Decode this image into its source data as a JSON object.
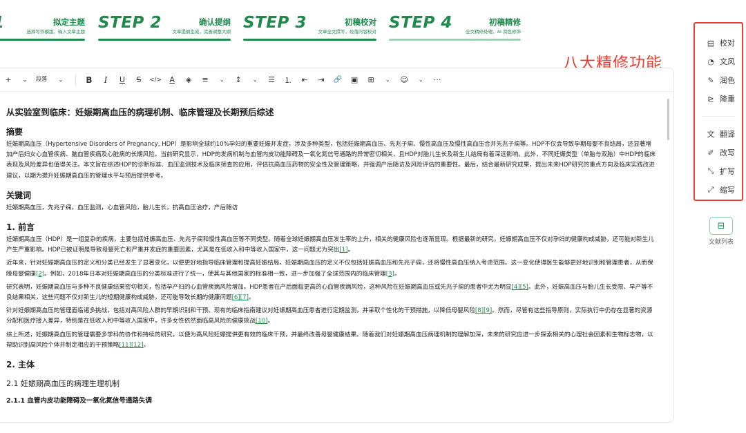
{
  "steps": [
    {
      "num": "",
      "title": "拟定主题",
      "desc": "选择写作模版，输入文章主题"
    },
    {
      "num": "STEP 2",
      "title": "确认提纲",
      "desc": "文章提纲生成，完善调整大纲"
    },
    {
      "num": "STEP 3",
      "title": "初稿校对",
      "desc": "文章全文撰写，段落内容校对"
    },
    {
      "num": "STEP 4",
      "title": "初稿精修",
      "desc": "全文精修处理，AI 润色修饰"
    }
  ],
  "step1_partial_num": "1",
  "annotation": "八大精修功能",
  "toolbar": {
    "add": "+",
    "paragraph": "段落",
    "bold": "B",
    "italic": "I",
    "underline": "U",
    "strike": "S",
    "code": "</>",
    "font_color": "A",
    "highlight": "◈",
    "align": "≡",
    "line_height": "↕",
    "bullet_list": "☰",
    "ordered_list": "⒈",
    "outdent": "⇤",
    "indent": "⇥",
    "link": "🔗",
    "image": "▣",
    "table": "⊞",
    "emoji": "☺",
    "more": "···"
  },
  "doc": {
    "title": "从实验室到临床：妊娠期高血压的病理机制、临床管理及长期预后综述",
    "abstract_heading": "摘要",
    "abstract": "妊娠期高血压（Hypertensive Disorders of Pregnancy, HDP）是影响全球约10%孕妇的重要妊娠并发症，涉及多种类型，包括妊娠期高血压、先兆子痫、慢性高血压及慢性高血压合并先兆子痫等。HDP不仅会导致孕期母婴不良结局，还显著增加产后妇女心血管疾病、脑血管疾病及心脏病的长期风险。当前研究显示，HDP的发病机制与血管内皮功能障碍及一氧化氮信号通路的异常密切相关，且HDP对胎儿生长及新生儿结局有着深远影响。此外，不同妊娠类型（单胎与双胎）中HDP的临床表现及风险差异也值得关注。本文旨在综述HDP的诊断标准、血压监测技术及临床筛查的应用，评估抗高血压药物的安全性及管理策略，并强调产后随访及风险评估的重要性。最后，结合最新研究成果，提出未来HDP研究的重点方向及临床实践改进建议，以期为提升妊娠期高血压的管理水平与预后提供参考。",
    "keywords_heading": "关键词",
    "keywords": "妊娠期高血压，先兆子痫，血压监测，心血管风险，胎儿生长，抗高血压治疗，产后随访",
    "sec1_heading": "1. 前言",
    "p1": "妊娠期高血压（HDP）是一组复杂的疾病，主要包括妊娠高血压、先兆子痫和慢性高血压等不同类型。随着全球妊娠期高血压发生率的上升，相关的健康风险也逐渐显现。根据最新的研究，妊娠期高血压不仅对孕妇的健康构成威胁，还可能对新生儿产生严重影响。HDP已被证明是导致母婴死亡和严重并发症的重要因素，尤其是在低收入和中等收入国家中，这一问题尤为突出",
    "p1_ref": "[1]",
    "p2a": "近年来，针对妊娠期高血压的定义和分类已经发生了显著变化，以便更好地指导临床管理和提高妊娠结局。妊娠期高血压的定义不仅包括妊娠高血压和先兆子痫，还将慢性高血压纳入考虑范围。这一变化使得医生能够更好地识别和管理患者，从而保障母婴健康",
    "p2_ref1": "[2]",
    "p2b": "。例如，2018年日本对妊娠期高血压的分类标准进行了统一，使其与其他国家的标准相一致，进一步加强了全球范围内的临床管理",
    "p2_ref2": "[3]",
    "p3a": "研究表明，妊娠期高血压与多种不良健康结果密切相关，包括孕产妇的心血管疾病风险增加。HDP患者在产后面临更高的心血管疾病风险，这种风险在妊娠期高血压或先兆子痫的患者中尤为明显",
    "p3_ref1": "[4][5]",
    "p3b": "。此外，妊娠高血压与胎儿生长受限、早产等不良结果相关，这些问题不仅对新生儿的短期健康构成威胁，还可能导致长期的健康问题",
    "p3_ref2": "[6][7]",
    "p4a": "针对妊娠期高血压的管理面临诸多挑战，包括对高风险人群的早期识别和干预。现有的临床指南建议对妊娠期高血压患者进行定期监测，并采取个性化的干预措施，以降低母婴风险",
    "p4_ref1": "[8][9]",
    "p4b": "。然而，尽管有这些指导原则，实际执行中仍存在显著的资源分配和医疗接入差异，特别是在低收入和中等收入国家中，许多女性依然面临高风险的健康挑战",
    "p4_ref2": "[10]",
    "p5": "综上所述，妊娠期高血压的管理需要多学科的协作和持续的研究，以便为高风险妊娠提供更有效的临床干预，并最终改善母婴健康结果。随着我们对妊娠期高血压病理机制的理解加深，未来的研究应进一步探索相关的心理社会因素和生物标志物，以帮助识别高风险个体并制定相应的干预策略",
    "p5_ref": "[11][12]",
    "sec2_heading": "2. 主体",
    "sub21_heading": "2.1 妊娠期高血压的病理生理机制",
    "sub211_heading": "2.1.1 血管内皮功能障碍及一氧化氮信号通路失调"
  },
  "panel": {
    "items": [
      {
        "icon": "▤",
        "label": "校对"
      },
      {
        "icon": "◔",
        "label": "文风"
      },
      {
        "icon": "✎",
        "label": "润色"
      },
      {
        "icon": "⊵",
        "label": "降重"
      },
      {
        "icon": "文",
        "label": "翻译"
      },
      {
        "icon": "✐",
        "label": "改写"
      },
      {
        "icon": "⤡",
        "label": "扩写"
      },
      {
        "icon": "⤢",
        "label": "缩写"
      }
    ]
  },
  "references_button": {
    "icon": "⊟",
    "label": "文献列表"
  },
  "colors": {
    "brand": "#1e8a4c",
    "annotation": "#e84033"
  }
}
